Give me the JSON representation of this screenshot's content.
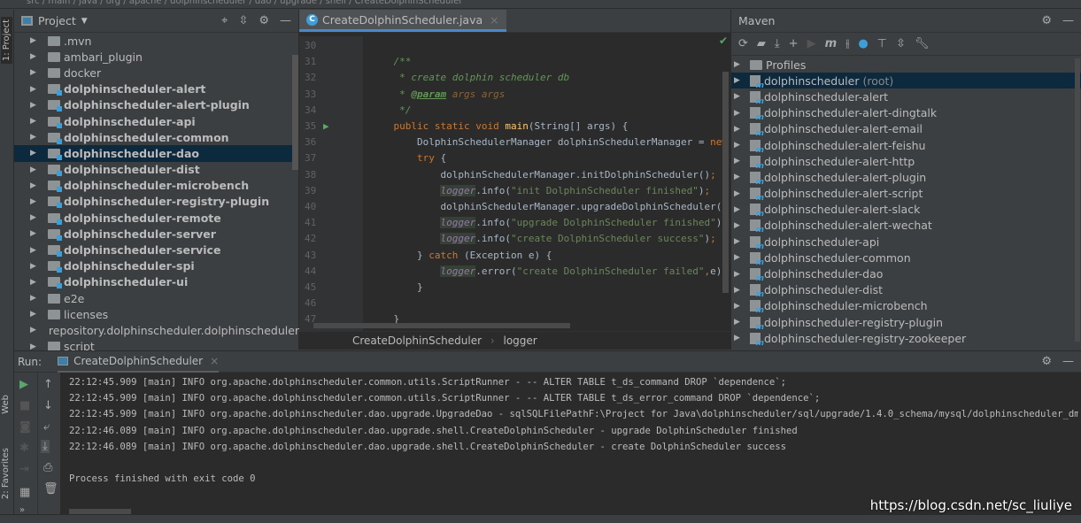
{
  "topbar": {
    "breadcrumb": "src / main / java / org / apache / dolphinscheduler / dao / upgrade / shell / CreateDolphinScheduler"
  },
  "left_strip": {
    "project_tab": "1: Project",
    "web_tab": "Web",
    "favorites_tab": "2: Favorites"
  },
  "project": {
    "title": "Project",
    "items": [
      {
        "label": ".mvn",
        "bold": false,
        "module": false
      },
      {
        "label": "ambari_plugin",
        "bold": false,
        "module": false
      },
      {
        "label": "docker",
        "bold": false,
        "module": false
      },
      {
        "label": "dolphinscheduler-alert",
        "bold": true,
        "module": true
      },
      {
        "label": "dolphinscheduler-alert-plugin",
        "bold": true,
        "module": true
      },
      {
        "label": "dolphinscheduler-api",
        "bold": true,
        "module": true
      },
      {
        "label": "dolphinscheduler-common",
        "bold": true,
        "module": true
      },
      {
        "label": "dolphinscheduler-dao",
        "bold": true,
        "module": true,
        "selected": true
      },
      {
        "label": "dolphinscheduler-dist",
        "bold": true,
        "module": true
      },
      {
        "label": "dolphinscheduler-microbench",
        "bold": true,
        "module": true
      },
      {
        "label": "dolphinscheduler-registry-plugin",
        "bold": true,
        "module": true
      },
      {
        "label": "dolphinscheduler-remote",
        "bold": true,
        "module": true
      },
      {
        "label": "dolphinscheduler-server",
        "bold": true,
        "module": true
      },
      {
        "label": "dolphinscheduler-service",
        "bold": true,
        "module": true
      },
      {
        "label": "dolphinscheduler-spi",
        "bold": true,
        "module": true
      },
      {
        "label": "dolphinscheduler-ui",
        "bold": true,
        "module": true
      },
      {
        "label": "e2e",
        "bold": false,
        "module": false
      },
      {
        "label": "licenses",
        "bold": false,
        "module": false
      },
      {
        "label": "repository.dolphinscheduler.dolphinscheduler-ui",
        "bold": false,
        "module": false
      },
      {
        "label": "script",
        "bold": false,
        "module": false
      }
    ]
  },
  "editor": {
    "tab": "CreateDolphinScheduler.java",
    "breadcrumb": [
      "CreateDolphinScheduler",
      "logger"
    ],
    "line_numbers": [
      "30",
      "31",
      "32",
      "33",
      "34",
      "35",
      "36",
      "37",
      "38",
      "39",
      "40",
      "41",
      "42",
      "43",
      "44",
      "45",
      "46",
      "47"
    ],
    "lines": [
      [],
      [
        {
          "t": "    /**",
          "c": "cm"
        }
      ],
      [
        {
          "t": "     * create dolphin scheduler db",
          "c": "cm"
        }
      ],
      [
        {
          "t": "     * ",
          "c": "cm"
        },
        {
          "t": "@param",
          "c": "tag"
        },
        {
          "t": " args args",
          "c": "pa"
        }
      ],
      [
        {
          "t": "     */",
          "c": "cm"
        }
      ],
      [
        {
          "t": "    public static void ",
          "c": "kw"
        },
        {
          "t": "main",
          "c": "fn"
        },
        {
          "t": "(String[] args) {",
          "c": ""
        }
      ],
      [
        {
          "t": "        DolphinSchedulerManager dolphinSchedulerManager = ",
          "c": ""
        },
        {
          "t": "new ",
          "c": "kw"
        },
        {
          "t": "DolphinSchedulerManager();",
          "c": ""
        }
      ],
      [
        {
          "t": "        try ",
          "c": "kw"
        },
        {
          "t": "{",
          "c": ""
        }
      ],
      [
        {
          "t": "            dolphinSchedulerManager.initDolphinScheduler()",
          "c": ""
        },
        {
          "t": ";",
          "c": "kw"
        }
      ],
      [
        {
          "t": "            ",
          "c": ""
        },
        {
          "t": "logger",
          "c": "lg"
        },
        {
          "t": ".info(",
          "c": ""
        },
        {
          "t": "\"init DolphinScheduler finished\"",
          "c": "st"
        },
        {
          "t": ")",
          "c": ""
        },
        {
          "t": ";",
          "c": "kw"
        }
      ],
      [
        {
          "t": "            dolphinSchedulerManager.upgradeDolphinScheduler()",
          "c": ""
        },
        {
          "t": ";",
          "c": "kw"
        }
      ],
      [
        {
          "t": "            ",
          "c": ""
        },
        {
          "t": "logger",
          "c": "lg"
        },
        {
          "t": ".info(",
          "c": ""
        },
        {
          "t": "\"upgrade DolphinScheduler finished\"",
          "c": "st"
        },
        {
          "t": ")",
          "c": ""
        },
        {
          "t": ";",
          "c": "kw"
        }
      ],
      [
        {
          "t": "            ",
          "c": ""
        },
        {
          "t": "logger",
          "c": "lg"
        },
        {
          "t": ".info(",
          "c": ""
        },
        {
          "t": "\"create DolphinScheduler success\"",
          "c": "st"
        },
        {
          "t": ")",
          "c": ""
        },
        {
          "t": ";",
          "c": "kw"
        }
      ],
      [
        {
          "t": "        } ",
          "c": ""
        },
        {
          "t": "catch ",
          "c": "kw"
        },
        {
          "t": "(Exception e) {",
          "c": ""
        }
      ],
      [
        {
          "t": "            ",
          "c": ""
        },
        {
          "t": "logger",
          "c": "lg"
        },
        {
          "t": ".error(",
          "c": ""
        },
        {
          "t": "\"create DolphinScheduler failed\"",
          "c": "st"
        },
        {
          "t": ",",
          "c": "kw"
        },
        {
          "t": "e)",
          "c": ""
        },
        {
          "t": ";",
          "c": "kw"
        }
      ],
      [
        {
          "t": "        }",
          "c": ""
        }
      ],
      [],
      [
        {
          "t": "    }",
          "c": ""
        }
      ]
    ]
  },
  "maven": {
    "title": "Maven",
    "items": [
      {
        "label": "Profiles",
        "suffix": ""
      },
      {
        "label": "dolphinscheduler",
        "suffix": "(root)",
        "selected": true
      },
      {
        "label": "dolphinscheduler-alert",
        "suffix": ""
      },
      {
        "label": "dolphinscheduler-alert-dingtalk",
        "suffix": ""
      },
      {
        "label": "dolphinscheduler-alert-email",
        "suffix": ""
      },
      {
        "label": "dolphinscheduler-alert-feishu",
        "suffix": ""
      },
      {
        "label": "dolphinscheduler-alert-http",
        "suffix": ""
      },
      {
        "label": "dolphinscheduler-alert-plugin",
        "suffix": ""
      },
      {
        "label": "dolphinscheduler-alert-script",
        "suffix": ""
      },
      {
        "label": "dolphinscheduler-alert-slack",
        "suffix": ""
      },
      {
        "label": "dolphinscheduler-alert-wechat",
        "suffix": ""
      },
      {
        "label": "dolphinscheduler-api",
        "suffix": ""
      },
      {
        "label": "dolphinscheduler-common",
        "suffix": ""
      },
      {
        "label": "dolphinscheduler-dao",
        "suffix": ""
      },
      {
        "label": "dolphinscheduler-dist",
        "suffix": ""
      },
      {
        "label": "dolphinscheduler-microbench",
        "suffix": ""
      },
      {
        "label": "dolphinscheduler-registry-plugin",
        "suffix": ""
      },
      {
        "label": "dolphinscheduler-registry-zookeeper",
        "suffix": ""
      }
    ]
  },
  "run": {
    "label": "Run:",
    "tab": "CreateDolphinScheduler",
    "lines": [
      "22:12:45.909 [main] INFO org.apache.dolphinscheduler.common.utils.ScriptRunner - -- ALTER TABLE t_ds_command DROP `dependence`;",
      "22:12:45.909 [main] INFO org.apache.dolphinscheduler.common.utils.ScriptRunner - -- ALTER TABLE t_ds_error_command DROP `dependence`;",
      "22:12:45.909 [main] INFO org.apache.dolphinscheduler.dao.upgrade.UpgradeDao - sqlSQLFilePathF:\\Project for Java\\dolphinscheduler/sql/upgrade/1.4.0_schema/mysql/dolphinscheduler_dm",
      "22:12:46.089 [main] INFO org.apache.dolphinscheduler.dao.upgrade.shell.CreateDolphinScheduler - upgrade DolphinScheduler finished",
      "22:12:46.089 [main] INFO org.apache.dolphinscheduler.dao.upgrade.shell.CreateDolphinScheduler - create DolphinScheduler success",
      "",
      "Process finished with exit code 0"
    ]
  },
  "watermark": "https://blog.csdn.net/sc_liuliye"
}
